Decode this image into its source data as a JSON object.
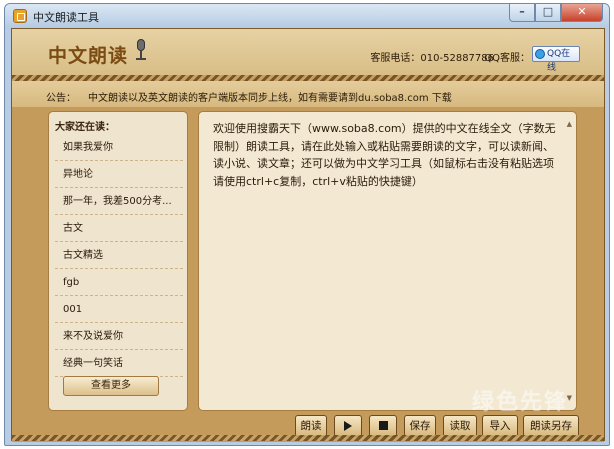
{
  "window": {
    "title": "中文朗读工具"
  },
  "header": {
    "logo": "中文朗读",
    "service_phone": "客服电话：010-52887786",
    "qq_label": "QQ客服：",
    "qq_status": "QQ在线"
  },
  "notice": {
    "label": "公告：",
    "text": "中文朗读以及英文朗读的客户端版本同步上线，如有需要请到du.soba8.com 下载"
  },
  "left_panel": {
    "title": "大家还在读：",
    "items": [
      "如果我爱你",
      "异地论",
      "那一年，我差500分考...",
      "古文",
      "古文精选",
      "fgb",
      "001",
      "来不及说爱你",
      "经典一句笑话"
    ],
    "more_button": "查看更多"
  },
  "editor": {
    "text": "欢迎使用搜霸天下（www.soba8.com）提供的中文在线全文（字数无限制）朗读工具，请在此处输入或粘贴需要朗读的文字，可以读新闻、读小说、读文章；还可以做为中文学习工具（如鼠标右击没有粘贴选项请使用ctrl+c复制，ctrl+v粘贴的快捷键）"
  },
  "toolbar": {
    "read_label": "朗读",
    "save_label": "保存",
    "load_label": "读取",
    "import_label": "导入",
    "saveas_label": "朗读另存"
  },
  "watermark": "绿色先锋"
}
